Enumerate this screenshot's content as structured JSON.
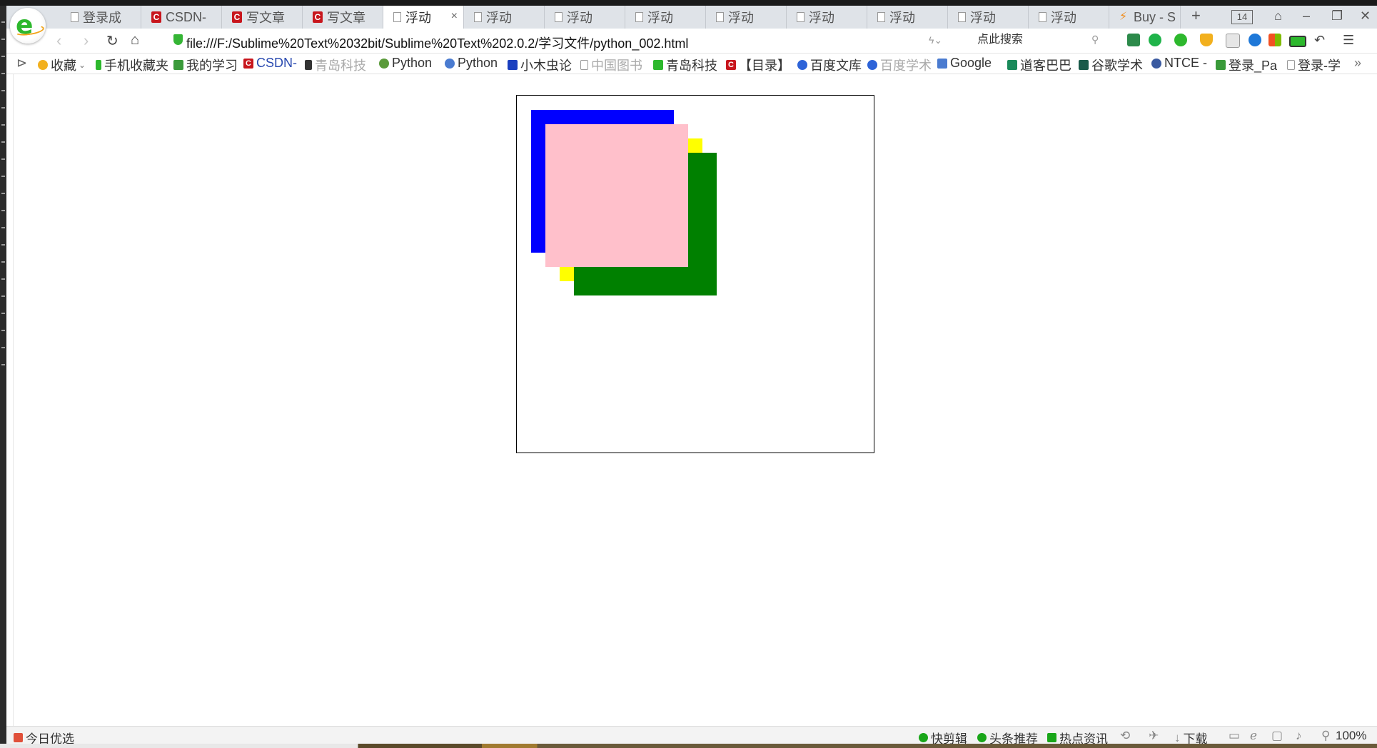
{
  "tabs": [
    {
      "label": "登录成",
      "icon": "doc-icon"
    },
    {
      "label": "CSDN-",
      "icon": "csdn-icon"
    },
    {
      "label": "写文章",
      "icon": "csdn-icon"
    },
    {
      "label": "写文章",
      "icon": "csdn-icon"
    },
    {
      "label": "浮动",
      "icon": "doc-icon",
      "active": true
    },
    {
      "label": "浮动",
      "icon": "doc-icon"
    },
    {
      "label": "浮动",
      "icon": "doc-icon"
    },
    {
      "label": "浮动",
      "icon": "doc-icon"
    },
    {
      "label": "浮动",
      "icon": "doc-icon"
    },
    {
      "label": "浮动",
      "icon": "doc-icon"
    },
    {
      "label": "浮动",
      "icon": "doc-icon"
    },
    {
      "label": "浮动",
      "icon": "doc-icon"
    },
    {
      "label": "浮动",
      "icon": "doc-icon"
    },
    {
      "label": "Buy - S",
      "icon": "buy-icon"
    }
  ],
  "tabbar": {
    "close_glyph": "×",
    "new_tab": "+",
    "tab_count": "14"
  },
  "address": {
    "url": "file:///F:/Sublime%20Text%2032bit/Sublime%20Text%202.0.2/学习文件/python_002.html",
    "search_placeholder": "点此搜索"
  },
  "bookmarks": [
    {
      "label": "收藏",
      "icon": "star-icon",
      "color": "#f2b01e"
    },
    {
      "label": "手机收藏夹",
      "icon": "phone-icon",
      "color": "#2db82d"
    },
    {
      "label": "我的学习",
      "icon": "book-icon",
      "color": "#3a9a3a"
    },
    {
      "label": "CSDN-",
      "icon": "csdn-icon",
      "color": "#c8161d"
    },
    {
      "label": "青岛科技",
      "icon": "d-icon",
      "color": "#333333"
    },
    {
      "label": "Python",
      "icon": "python-icon",
      "color": "#5a9a3a"
    },
    {
      "label": "Python",
      "icon": "rocket-icon",
      "color": "#4a7bd0"
    },
    {
      "label": "小木虫论",
      "icon": "grid-icon",
      "color": "#1a3fbf"
    },
    {
      "label": "中国图书",
      "icon": "doc-icon",
      "color": "#999999"
    },
    {
      "label": "青岛科技",
      "icon": "q-icon",
      "color": "#2db82d"
    },
    {
      "label": "【目录】",
      "icon": "csdn-icon",
      "color": "#c8161d"
    },
    {
      "label": "百度文库",
      "icon": "paw-icon",
      "color": "#2d63d8"
    },
    {
      "label": "百度学术",
      "icon": "paw-icon",
      "color": "#2d63d8"
    },
    {
      "label": "Google",
      "icon": "translate-icon",
      "color": "#4a7bd0"
    },
    {
      "label": "道客巴巴",
      "icon": "doc88-icon",
      "color": "#1a8a5a"
    },
    {
      "label": "谷歌学术",
      "icon": "scholar-icon",
      "color": "#1a5a4a"
    },
    {
      "label": "NTCE -",
      "icon": "globe-icon",
      "color": "#3a5aa0"
    },
    {
      "label": "登录_Pa",
      "icon": "pp-icon",
      "color": "#3a9a3a"
    },
    {
      "label": "登录-学",
      "icon": "doc-icon",
      "color": "#999999"
    }
  ],
  "bookmarks_more": "»",
  "page": {
    "colors": {
      "blue": "#0000ff",
      "yellow": "#ffff00",
      "green": "#008000",
      "pink": "#ffc0cb"
    }
  },
  "status": {
    "left": "今日优选",
    "items": [
      "快剪辑",
      "头条推荐",
      "热点资讯",
      "下载"
    ],
    "zoom": "100%"
  }
}
